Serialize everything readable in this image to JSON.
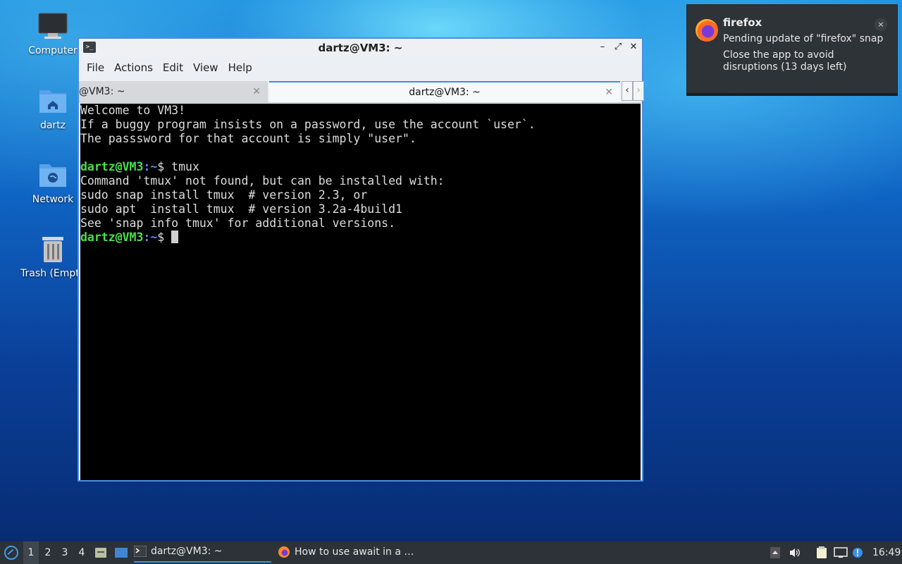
{
  "desktop": {
    "icons": [
      {
        "label": "Computer"
      },
      {
        "label": "dartz"
      },
      {
        "label": "Network"
      },
      {
        "label": "Trash (Empt"
      }
    ]
  },
  "window": {
    "title": "dartz@VM3: ~",
    "buttons": {
      "minimize": "–",
      "maximize": "⤢",
      "close": "✕"
    },
    "menu": [
      "File",
      "Actions",
      "Edit",
      "View",
      "Help"
    ],
    "tabs": [
      {
        "label": "@VM3: ~",
        "close": "✕"
      },
      {
        "label": "dartz@VM3: ~",
        "close": "✕"
      }
    ],
    "tab_nav": {
      "prev": "‹",
      "next": "›"
    }
  },
  "terminal": {
    "lines": [
      "Welcome to VM3!",
      "If a buggy program insists on a password, use the account `user`.",
      "The passsword for that account is simply \"user\".",
      "",
      "Command 'tmux' not found, but can be installed with:",
      "sudo snap install tmux  # version 2.3, or",
      "sudo apt  install tmux  # version 3.2a-4build1",
      "See 'snap info tmux' for additional versions."
    ],
    "prompt_user": "dartz@VM3",
    "prompt_sep": ":",
    "prompt_path": "~",
    "prompt_sym": "$ ",
    "command": "tmux"
  },
  "notification": {
    "app": "firefox",
    "line1": "Pending update of \"firefox\" snap",
    "line2": "Close the app to avoid disruptions (13 days left)",
    "close": "×"
  },
  "taskbar": {
    "workspaces": [
      "1",
      "2",
      "3",
      "4"
    ],
    "tasks": [
      {
        "label": "dartz@VM3: ~"
      },
      {
        "label": "How to use await in a …"
      }
    ],
    "clock": "16:49"
  },
  "colors": {
    "prompt_user": "#4be04b",
    "prompt_path": "#5b8cff",
    "accent": "#3d8ee6"
  }
}
